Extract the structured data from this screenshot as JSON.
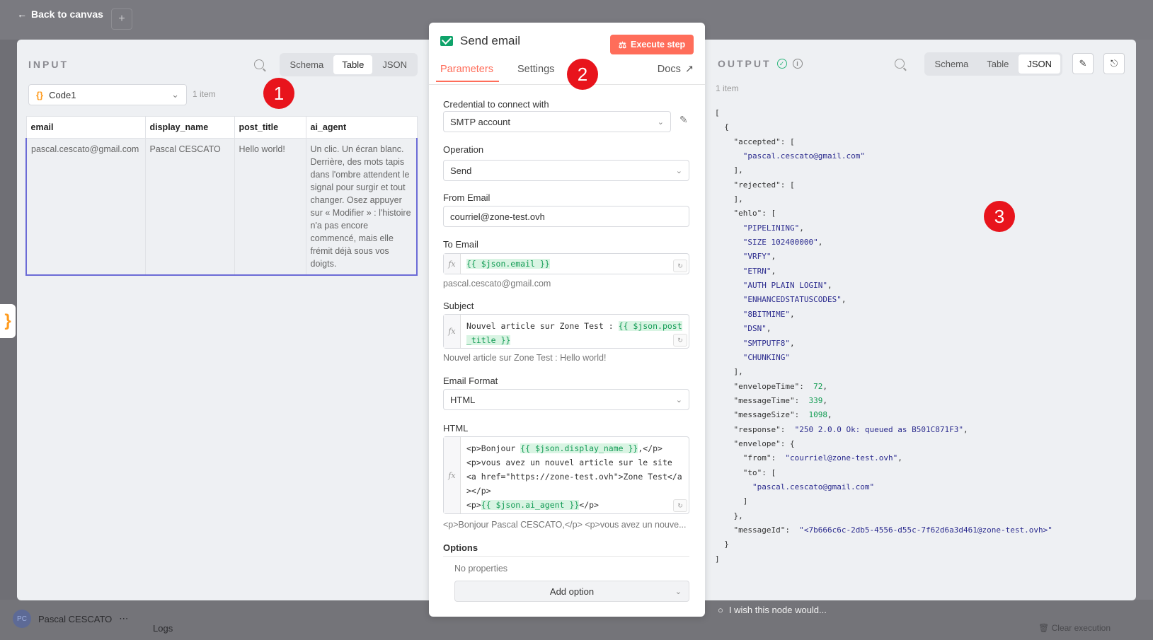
{
  "background": {
    "back_label": "Back to canvas",
    "user_initials": "PC",
    "user_name": "Pascal CESCATO",
    "logs": "Logs",
    "clear_execution": "Clear execution",
    "wish": "I wish this node would..."
  },
  "input": {
    "title": "INPUT",
    "views": [
      "Schema",
      "Table",
      "JSON"
    ],
    "active_view": "Table",
    "node": "Code1",
    "item_count": "1 item",
    "columns": [
      "email",
      "display_name",
      "post_title",
      "ai_agent"
    ],
    "rows": [
      [
        "pascal.cescato@gmail.com",
        "Pascal CESCATO",
        "Hello world!",
        "Un clic. Un écran blanc. Derrière, des mots tapis dans l'ombre attendent le signal pour surgir et tout changer. Osez appuyer sur « Modifier » : l'histoire n'a pas encore commencé, mais elle frémit déjà sous vos doigts."
      ]
    ]
  },
  "node": {
    "title": "Send email",
    "execute_label": "Execute step",
    "tabs": [
      "Parameters",
      "Settings"
    ],
    "active_tab": "Parameters",
    "docs": "Docs",
    "credential_label": "Credential to connect with",
    "credential_value": "SMTP account",
    "operation_label": "Operation",
    "operation_value": "Send",
    "from_label": "From Email",
    "from_value": "courriel@zone-test.ovh",
    "to_label": "To Email",
    "to_expr": "{{ $json.email }}",
    "to_preview": "pascal.cescato@gmail.com",
    "subject_label": "Subject",
    "subject_prefix": "Nouvel article sur Zone Test : ",
    "subject_expr": "{{ $json.post_title }}",
    "subject_preview": "Nouvel article sur Zone Test : Hello world!",
    "format_label": "Email Format",
    "format_value": "HTML",
    "html_label": "HTML",
    "html_line1_prefix": "<p>Bonjour ",
    "html_line1_expr": "{{ $json.display_name }}",
    "html_line1_suffix": ",</p>",
    "html_line2": "<p>vous avez un nouvel article sur le  site",
    "html_line3": " <a href=\"https://zone-test.ovh\">Zone Test</a></p>",
    "html_line4_prefix": " <p>",
    "html_line4_expr": "{{ $json.ai_agent }}",
    "html_line4_suffix": "</p>",
    "html_preview": "<p>Bonjour Pascal CESCATO,</p> <p>vous avez un nouve...",
    "options_label": "Options",
    "no_properties": "No properties",
    "add_option": "Add option"
  },
  "output": {
    "title": "OUTPUT",
    "views": [
      "Schema",
      "Table",
      "JSON"
    ],
    "active_view": "JSON",
    "item_count": "1 item",
    "accepted": [
      "pascal.cescato@gmail.com"
    ],
    "ehlo": [
      "PIPELINING",
      "SIZE 102400000",
      "VRFY",
      "ETRN",
      "AUTH PLAIN LOGIN",
      "ENHANCEDSTATUSCODES",
      "8BITMIME",
      "DSN",
      "SMTPUTF8",
      "CHUNKING"
    ],
    "envelopeTime": "72",
    "messageTime": "339",
    "messageSize": "1098",
    "response": "\"250 2.0.0 Ok: queued as B501C871F3\"",
    "envelope_from": "\"courriel@zone-test.ovh\"",
    "envelope_to": "\"pascal.cescato@gmail.com\"",
    "messageId": "\"<7b666c6c-2db5-4556-d55c-7f62d6a3d461@zone-test.ovh>\""
  },
  "badges": [
    "1",
    "2",
    "3"
  ]
}
